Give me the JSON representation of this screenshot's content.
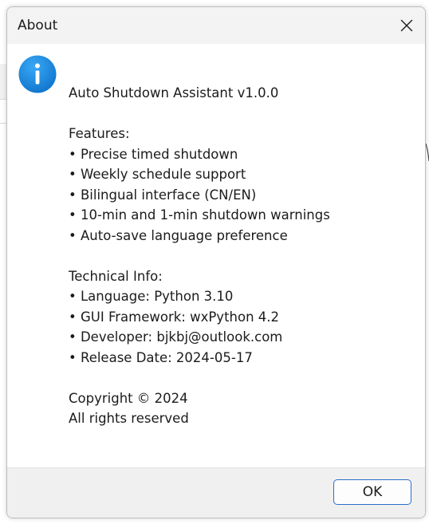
{
  "window": {
    "title": "About"
  },
  "message": {
    "app_name": "Auto Shutdown Assistant v1.0.0",
    "features_heading": "Features:",
    "features": [
      "• Precise timed shutdown",
      "• Weekly schedule support",
      "• Bilingual interface (CN/EN)",
      "• 10-min and 1-min shutdown warnings",
      "• Auto-save language preference"
    ],
    "tech_heading": "Technical Info:",
    "tech": [
      "• Language: Python 3.10",
      "• GUI Framework: wxPython 4.2",
      "• Developer: bjkbj@outlook.com",
      "• Release Date: 2024-05-17"
    ],
    "copyright": "Copyright © 2024",
    "rights": "All rights reserved"
  },
  "buttons": {
    "ok_label": "OK"
  },
  "icons": {
    "info": "info-icon",
    "close": "close-icon"
  },
  "colors": {
    "info_blue": "#1a8ee8",
    "button_border": "#2a6fc9",
    "titlebar": "#f3f3f3",
    "footer": "#f0f0f0"
  }
}
